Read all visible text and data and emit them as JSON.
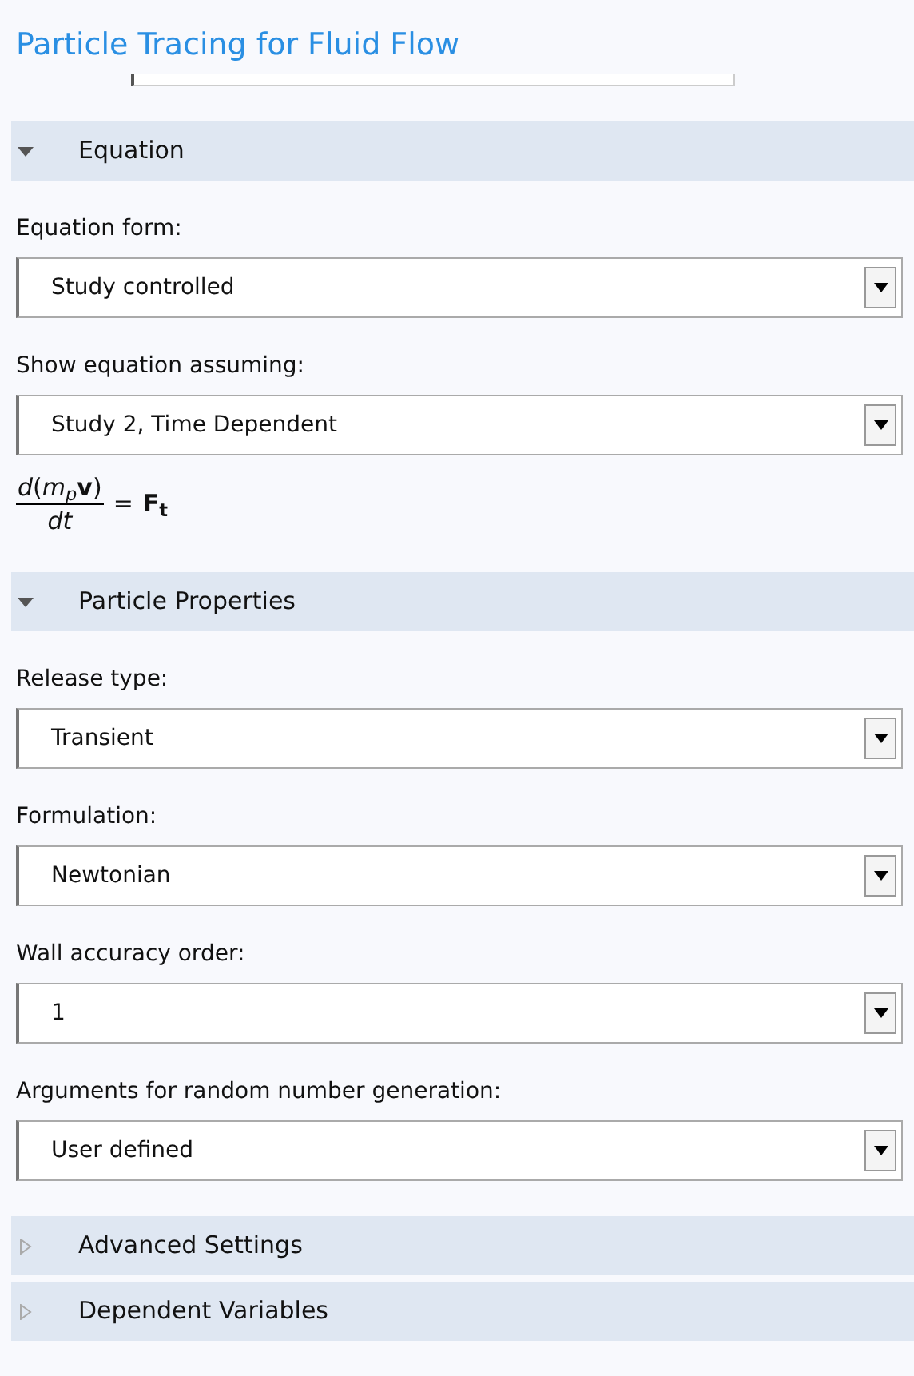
{
  "title": "Particle Tracing for Fluid Flow",
  "sections": [
    {
      "title": "Equation",
      "expanded": true,
      "items": [
        {
          "kind": "select",
          "label": "Equation form:",
          "value": "Study controlled"
        },
        {
          "kind": "select",
          "label": "Show equation assuming:",
          "value": "Study 2, Time Dependent"
        },
        {
          "kind": "equation",
          "numerator": "*d*(*m*$_{p}$**v**)",
          "denominator": "dt",
          "equals": "=",
          "rhs": "**F**$_{t}$"
        }
      ]
    },
    {
      "title": "Particle Properties",
      "expanded": true,
      "items": [
        {
          "kind": "select",
          "label": "Release type:",
          "value": "Transient"
        },
        {
          "kind": "select",
          "label": "Formulation:",
          "value": "Newtonian"
        },
        {
          "kind": "select",
          "label": "Wall accuracy order:",
          "value": "1"
        },
        {
          "kind": "select",
          "label": "Arguments for random number generation:",
          "value": "User defined"
        }
      ]
    },
    {
      "title": "Advanced Settings",
      "expanded": false
    },
    {
      "title": "Dependent Variables",
      "expanded": false
    }
  ]
}
